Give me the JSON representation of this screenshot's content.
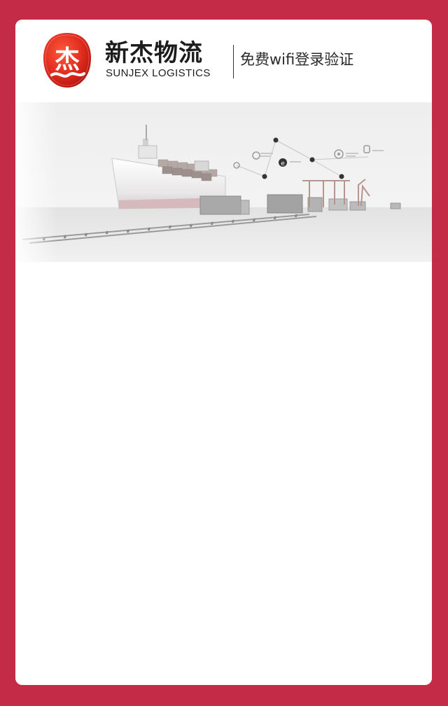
{
  "page": {
    "background_color": "#c42b47",
    "card_color": "#ffffff"
  },
  "header": {
    "logo": {
      "icon": "sunjex-logo-icon",
      "mark_text": "杰",
      "color": "#e02b1e"
    },
    "brand_name_cn": "新杰物流",
    "brand_name_en": "SUNJEX LOGISTICS",
    "portal_title": "免费wifi登录验证"
  },
  "banner": {
    "description_icon": "logistics-banner-illustration",
    "network_icons": [
      "clock-icon",
      "ie-browser-icon",
      "settings-icon",
      "touch-icon"
    ]
  }
}
